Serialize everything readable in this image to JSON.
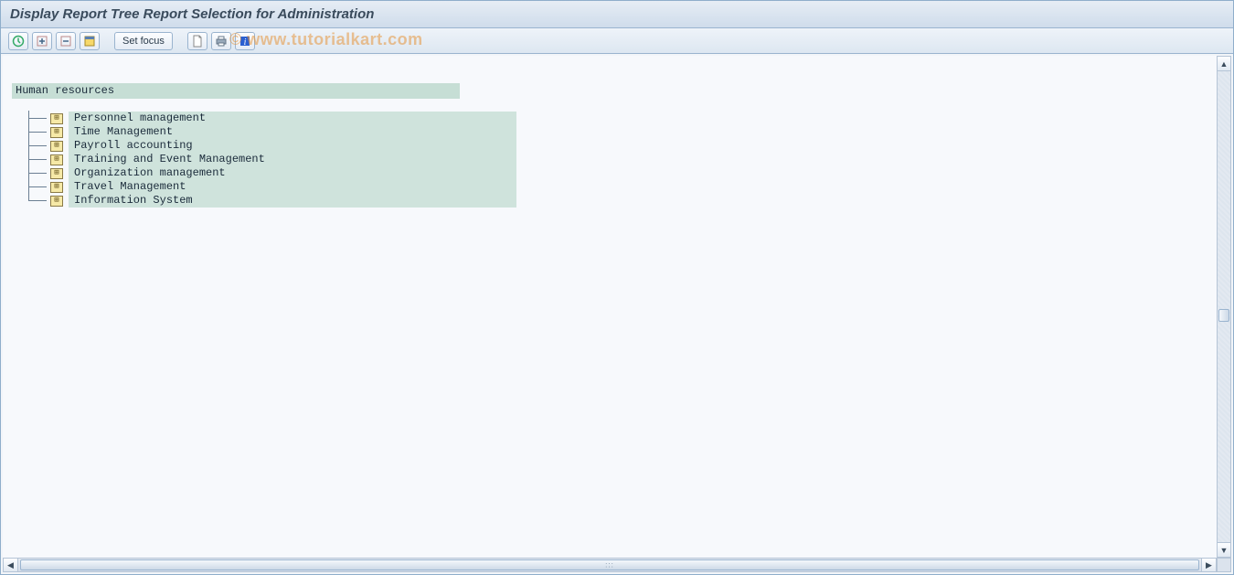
{
  "title": "Display Report Tree Report Selection for Administration",
  "toolbar": {
    "set_focus_label": "Set focus"
  },
  "watermark": "© www.tutorialkart.com",
  "tree": {
    "root": "Human resources",
    "children": [
      "Personnel management",
      "Time Management",
      "Payroll accounting",
      "Training and Event Management",
      "Organization management",
      "Travel Management",
      "Information System"
    ]
  }
}
